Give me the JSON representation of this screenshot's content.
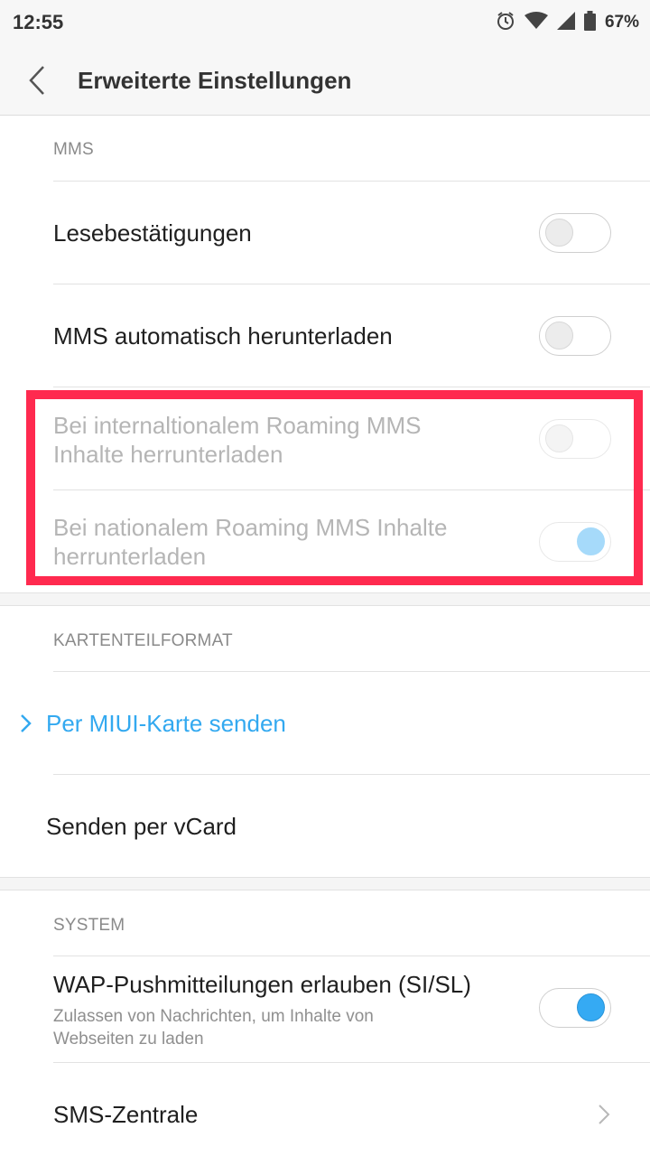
{
  "status_bar": {
    "time": "12:55",
    "battery": "67%",
    "icons": [
      "alarm-icon",
      "wifi-icon",
      "signal-icon",
      "battery-icon"
    ]
  },
  "header": {
    "title": "Erweiterte Einstellungen",
    "back_icon": "back-arrow-icon"
  },
  "sections": {
    "mms": {
      "label": "MMS",
      "read_receipts": {
        "label": "Lesebestätigungen",
        "enabled": false
      },
      "auto_download": {
        "label": "MMS automatisch herunterladen",
        "enabled": false
      },
      "intl_roaming": {
        "label_line1": "Bei internaltionalem Roaming MMS",
        "label_line2": "Inhalte herrunterladen",
        "enabled": false,
        "disabled": true
      },
      "national_roaming": {
        "label_line1": "Bei nationalem Roaming MMS Inhalte",
        "label_line2": "herrunterladen",
        "enabled": true,
        "disabled": true
      }
    },
    "card_format": {
      "label": "KARTENTEILFORMAT",
      "miui_card": {
        "label": "Per MIUI-Karte senden",
        "selected": true
      },
      "vcard": {
        "label": "Senden per vCard",
        "selected": false
      }
    },
    "system": {
      "label": "SYSTEM",
      "wap_push": {
        "label": "WAP-Pushmitteilungen erlauben (SI/SL)",
        "sub_line1": "Zulassen von Nachrichten, um Inhalte von",
        "sub_line2": "Webseiten zu laden",
        "enabled": true
      },
      "sms_center": {
        "label": "SMS-Zentrale"
      }
    }
  },
  "colors": {
    "accent": "#33a9f0",
    "highlight": "#ff2a4f",
    "divider": "#e2e2e2"
  }
}
